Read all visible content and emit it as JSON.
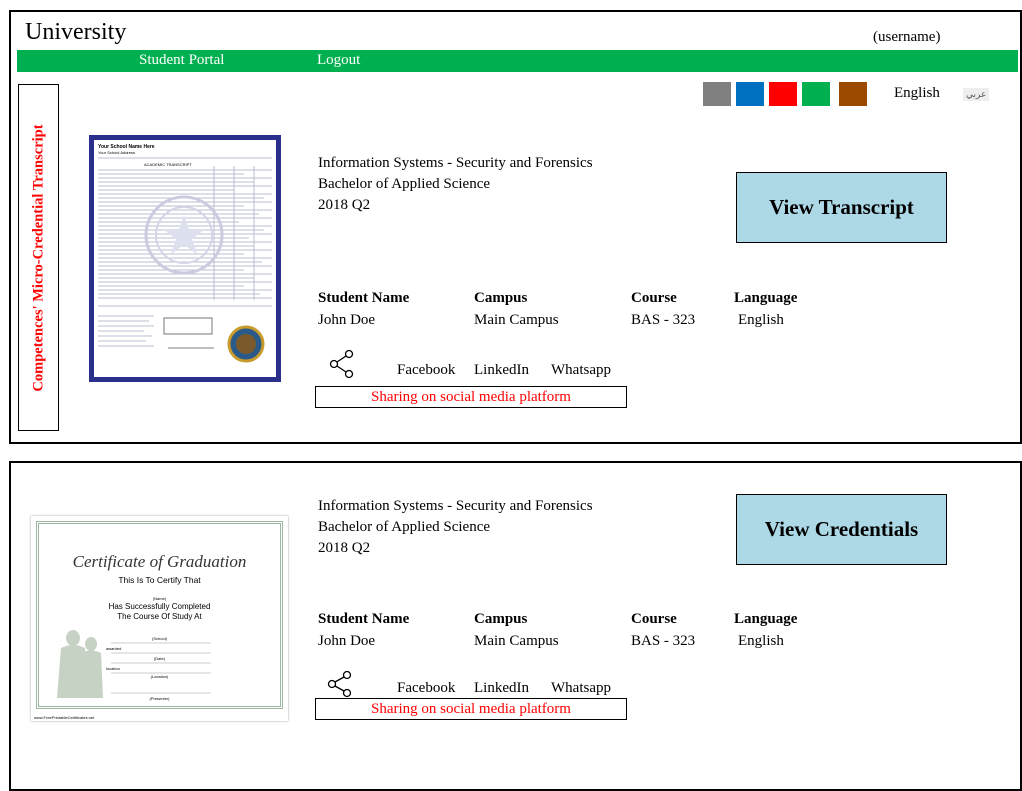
{
  "header": {
    "title": "University",
    "username": "(username)"
  },
  "nav": {
    "items": [
      "Student Portal",
      "Logout"
    ]
  },
  "theme_colors": [
    "#808080",
    "#0070c0",
    "#ff0000",
    "#00b050",
    "#9c4a00"
  ],
  "language": {
    "current": "English",
    "alt": "عربي"
  },
  "side_label": "Competences' Micro-Credential Transcript",
  "cards": [
    {
      "program": "Information Systems - Security and Forensics",
      "degree": "Bachelor of Applied Science",
      "term": "2018 Q2",
      "action_label": "View Transcript",
      "headers": [
        "Student Name",
        "Campus",
        "Course",
        "Language"
      ],
      "values": [
        "John Doe",
        "Main Campus",
        "BAS - 323",
        "English"
      ],
      "social": [
        "Facebook",
        "LinkedIn",
        "Whatsapp"
      ],
      "share_text": "Sharing on social media platform",
      "transcript_doc": {
        "school": "Your School Name Here",
        "address": "Your School Address",
        "heading": "ACADEMIC TRANSCRIPT"
      }
    },
    {
      "program": "Information Systems - Security and Forensics",
      "degree": "Bachelor of Applied Science",
      "term": "2018 Q2",
      "action_label": "View Credentials",
      "headers": [
        "Student Name",
        "Campus",
        "Course",
        "Language"
      ],
      "values": [
        "John Doe",
        "Main Campus",
        "BAS - 323",
        "English"
      ],
      "social": [
        "Facebook",
        "LinkedIn",
        "Whatsapp"
      ],
      "share_text": "Sharing on social media platform",
      "certificate": {
        "title": "Certificate of Graduation",
        "line1": "This Is To Certify That",
        "name": "(Name)",
        "line2": "Has Successfully Completed",
        "line3": "The Course Of Study At",
        "school": "(School)",
        "awarded": "awarded",
        "date": "(Date)",
        "location_label": "location",
        "location": "(Location)",
        "presenter": "(Presenter)",
        "footer": "www.FreePrintableCertificates.net"
      }
    }
  ]
}
